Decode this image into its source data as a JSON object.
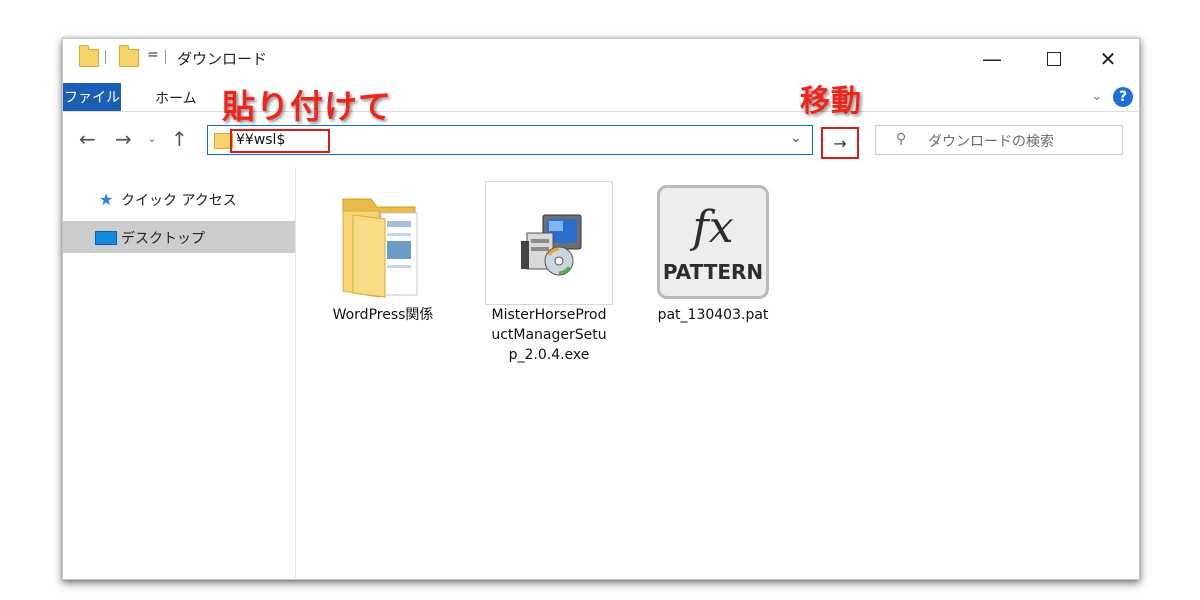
{
  "window": {
    "title": "ダウンロード",
    "pin_symbol": "=",
    "controls": {
      "minimize": "—",
      "close": "✕"
    }
  },
  "ribbon": {
    "tabs": [
      {
        "label": "ファイル"
      },
      {
        "label": "ホーム"
      }
    ],
    "collapse_symbol": "⌄",
    "help_symbol": "?"
  },
  "nav": {
    "back_symbol": "←",
    "forward_symbol": "→",
    "recent_symbol": "⌄",
    "up_symbol": "↑",
    "address_value": "¥¥wsl$",
    "address_dropdown_symbol": "⌄",
    "go_symbol": "→",
    "search_placeholder": "ダウンロードの検索",
    "search_icon_symbol": "⚲"
  },
  "annotations": {
    "paste_label": "貼り付けて",
    "move_label": "移動",
    "highlight_color": "#d81b1b"
  },
  "sidebar": {
    "items": [
      {
        "label": "クイック アクセス",
        "icon": "star-icon",
        "selected": false
      },
      {
        "label": "デスクトップ",
        "icon": "desktop-icon",
        "selected": true
      }
    ]
  },
  "files": [
    {
      "name": "WordPress関係",
      "icon": "folder-icon"
    },
    {
      "name": "MisterHorseProductManagerSetup_2.0.4.exe",
      "name_lines": [
        "MisterHorseProd",
        "uctManagerSetu",
        "p_2.0.4.exe"
      ],
      "icon": "installer-icon"
    },
    {
      "name": "pat_130403.pat",
      "icon": "fx-pattern-icon",
      "icon_text": "fx",
      "icon_subtext": "PATTERN"
    }
  ],
  "colors": {
    "accent": "#1a5fb4",
    "folder": "#f6d36a",
    "callout": "#f0241b"
  }
}
